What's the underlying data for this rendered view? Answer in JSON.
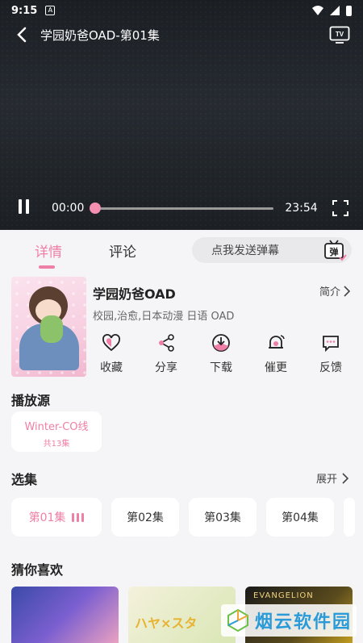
{
  "status_bar": {
    "time": "9:15",
    "notification_glyph": "A"
  },
  "player": {
    "title": "学园奶爸OAD-第01集",
    "current_time": "00:00",
    "total_time": "23:54",
    "progress": 0,
    "tv_label": "TV"
  },
  "tabs": [
    {
      "label": "详情",
      "active": true
    },
    {
      "label": "评论",
      "active": false
    }
  ],
  "danmaku": {
    "placeholder": "点我发送弹幕",
    "icon_glyph": "弹"
  },
  "anime": {
    "title": "学园奶爸OAD",
    "intro_label": "简介",
    "tags": "校园,治愈,日本动漫 日语 OAD"
  },
  "actions": [
    {
      "label": "收藏",
      "icon": "heart-icon"
    },
    {
      "label": "分享",
      "icon": "share-icon"
    },
    {
      "label": "下载",
      "icon": "download-icon"
    },
    {
      "label": "催更",
      "icon": "bell-icon"
    },
    {
      "label": "反馈",
      "icon": "feedback-icon"
    }
  ],
  "sources": {
    "heading": "播放源",
    "items": [
      {
        "name": "Winter-CO线",
        "count": "共13集"
      }
    ]
  },
  "episodes": {
    "heading": "选集",
    "expand_label": "展开",
    "items": [
      {
        "label": "第01集",
        "active": true
      },
      {
        "label": "第02集",
        "active": false
      },
      {
        "label": "第03集",
        "active": false
      },
      {
        "label": "第04集",
        "active": false
      }
    ]
  },
  "recommendations": {
    "heading": "猜你喜欢",
    "items": [
      {
        "thumb_text": ""
      },
      {
        "thumb_text": "ハヤ×スタ"
      },
      {
        "thumb_text": "EVANGELION"
      }
    ]
  },
  "watermark": {
    "text": "烟云软件园"
  },
  "colors": {
    "accent": "#ef7fa5",
    "player_bg": "#1f2328",
    "content_bg": "#f5f5f7"
  }
}
